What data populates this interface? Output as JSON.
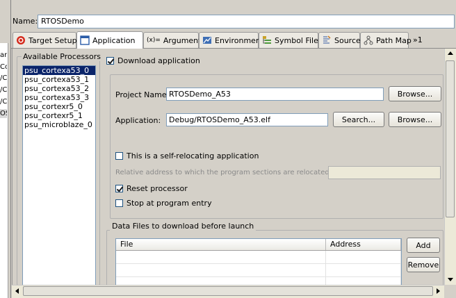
{
  "left_panel": {
    "fragments": [
      "ar",
      "Co",
      "/C",
      "/C",
      "/C",
      "OS"
    ]
  },
  "name": {
    "label": "Name:",
    "value": "RTOSDemo"
  },
  "tabs": [
    {
      "label": "Target Setup",
      "icon": "target-icon"
    },
    {
      "label": "Application",
      "icon": "application-icon"
    },
    {
      "label": "Arguments",
      "icon": "arguments-icon",
      "icon_text": "(x)="
    },
    {
      "label": "Environment",
      "icon": "environment-icon"
    },
    {
      "label": "Symbol Files",
      "icon": "symbol-files-icon"
    },
    {
      "label": "Source",
      "icon": "source-icon"
    },
    {
      "label": "Path Map",
      "icon": "path-map-icon"
    },
    {
      "label": "»1",
      "icon": "overflow-tabs-icon"
    }
  ],
  "processors": {
    "title": "Available Processors",
    "items": [
      "psu_cortexa53_0",
      "psu_cortexa53_1",
      "psu_cortexa53_2",
      "psu_cortexa53_3",
      "psu_cortexr5_0",
      "psu_cortexr5_1",
      "psu_microblaze_0"
    ],
    "selected_index": 0
  },
  "application": {
    "download_label": "Download application",
    "download_checked": true,
    "project_name_label": "Project Name:",
    "project_name_value": "RTOSDemo_A53",
    "application_label": "Application:",
    "application_value": "Debug/RTOSDemo_A53.elf",
    "browse_label": "Browse...",
    "search_label": "Search...",
    "self_relocating_label": "This is a self-relocating application",
    "self_relocating_checked": false,
    "relative_address_label": "Relative address to which the program sections are relocated:",
    "relative_address_value": "",
    "reset_processor_label": "Reset processor",
    "reset_processor_checked": true,
    "stop_at_entry_label": "Stop at program entry",
    "stop_at_entry_checked": false
  },
  "data_files": {
    "title": "Data Files to download before launch",
    "columns": [
      "File",
      "Address"
    ],
    "add_label": "Add",
    "remove_label": "Remove"
  },
  "colors": {
    "selection": "#0a246a",
    "check": "#21a121",
    "window": "#d4d0c8"
  }
}
